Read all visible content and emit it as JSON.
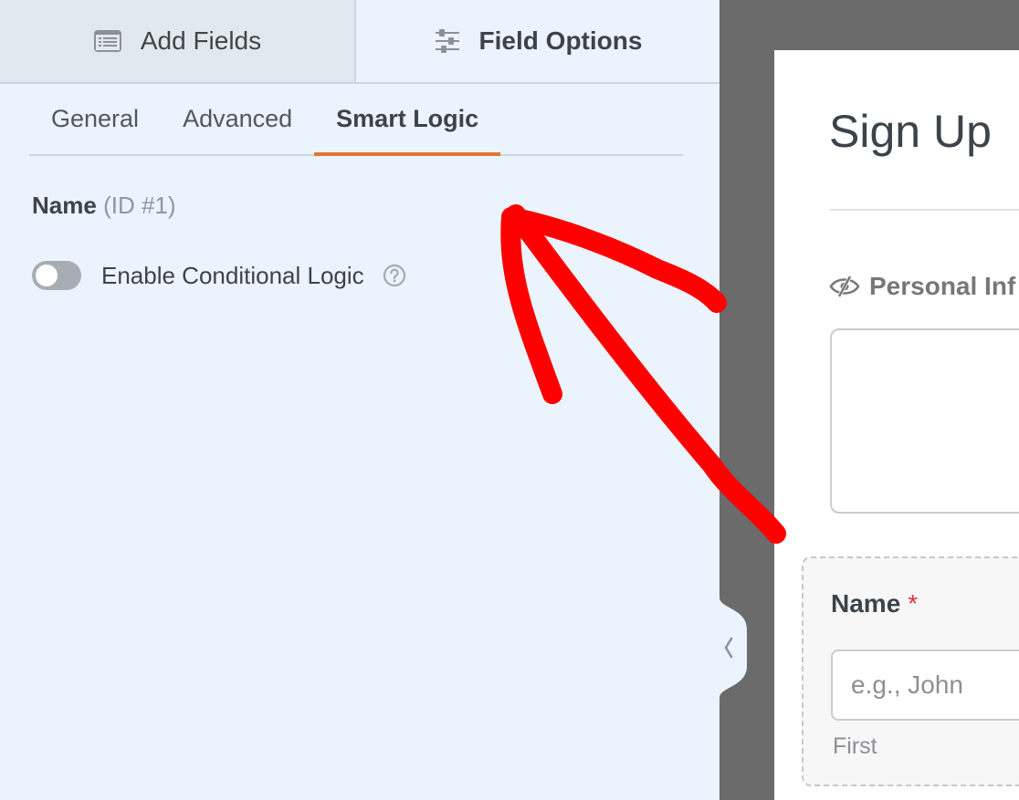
{
  "top_tabs": [
    {
      "label": "Add Fields",
      "icon": "list-icon",
      "active": false
    },
    {
      "label": "Field Options",
      "icon": "sliders-icon",
      "active": true
    }
  ],
  "sub_tabs": [
    {
      "label": "General",
      "active": false
    },
    {
      "label": "Advanced",
      "active": false
    },
    {
      "label": "Smart Logic",
      "active": true
    }
  ],
  "field": {
    "name": "Name",
    "id_label": "(ID #1)"
  },
  "conditional_logic": {
    "label": "Enable Conditional Logic",
    "enabled": false,
    "help_icon": "question-circle-icon"
  },
  "preview": {
    "form_title": "Sign Up",
    "section_label": "Personal Inf",
    "field_label": "Name",
    "required_mark": "*",
    "input_placeholder": "e.g., John",
    "sublabel": "First"
  },
  "colors": {
    "accent": "#e27730",
    "panel_bg": "#ebf3fc",
    "annotation_arrow": "#ff0000",
    "required": "#d63638"
  }
}
